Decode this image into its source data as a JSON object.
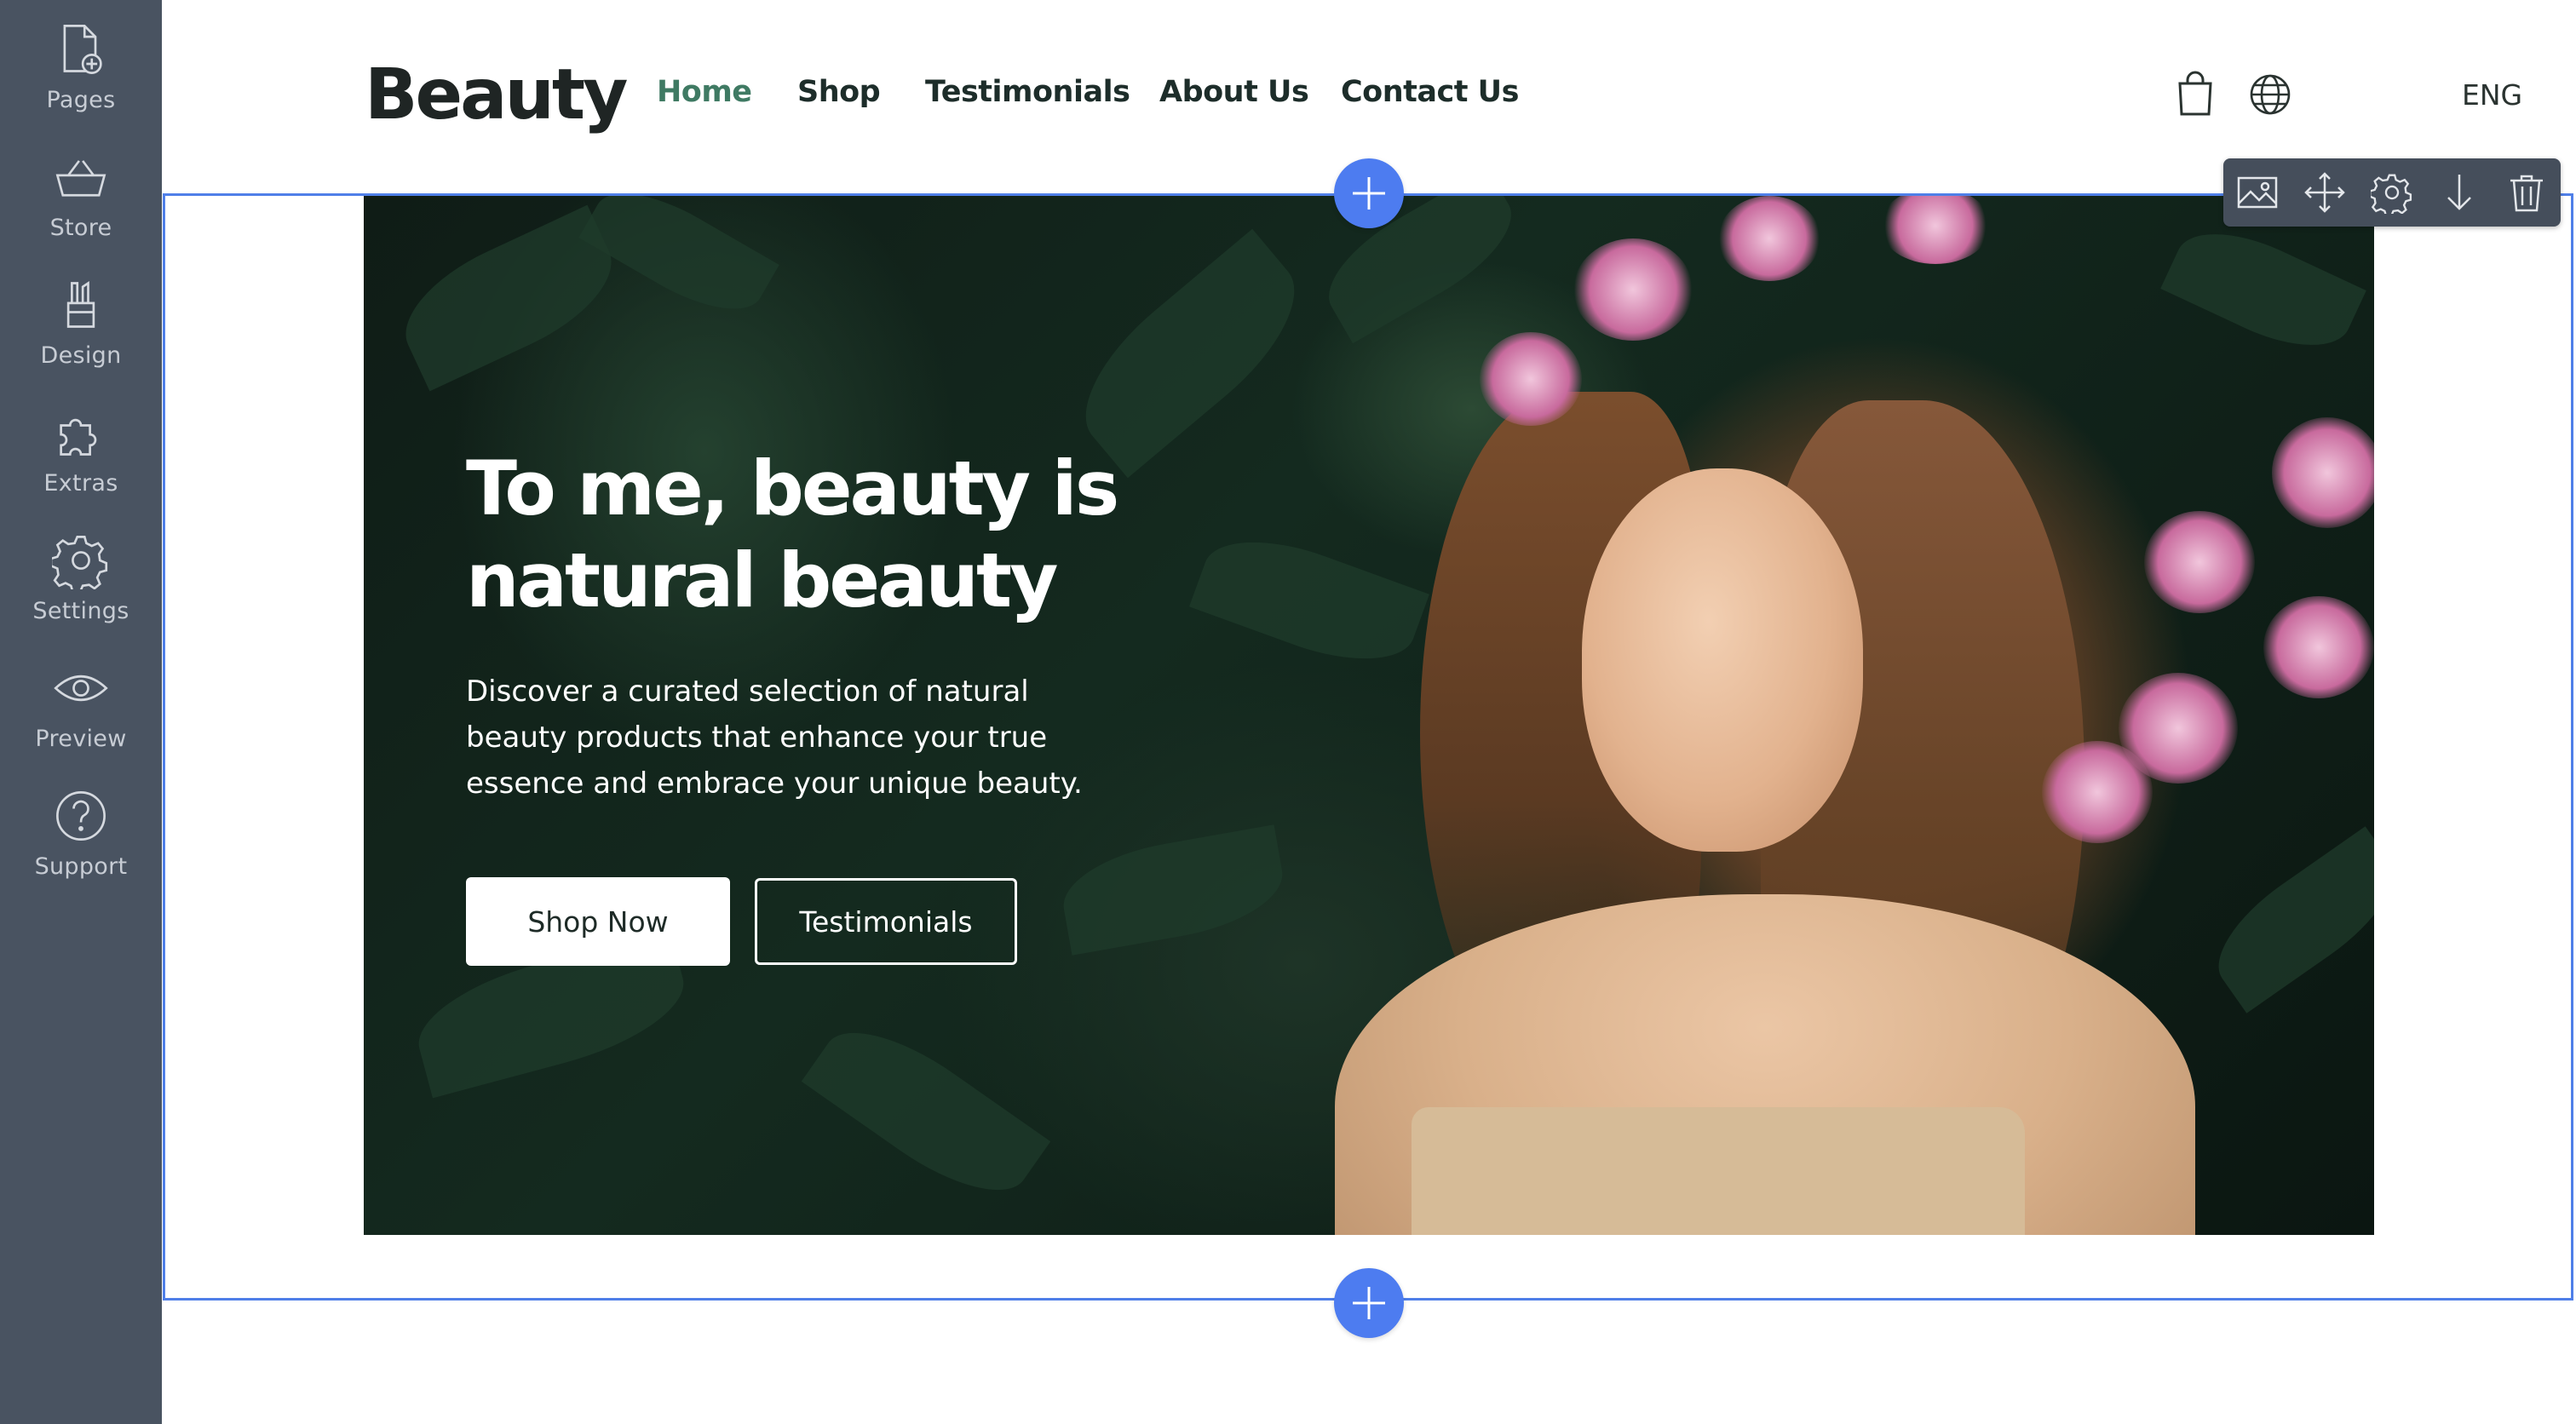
{
  "sidebar": {
    "items": [
      {
        "label": "Pages",
        "icon": "page-add-icon"
      },
      {
        "label": "Store",
        "icon": "basket-icon"
      },
      {
        "label": "Design",
        "icon": "brush-icon"
      },
      {
        "label": "Extras",
        "icon": "puzzle-icon"
      },
      {
        "label": "Settings",
        "icon": "gear-icon"
      },
      {
        "label": "Preview",
        "icon": "eye-icon"
      },
      {
        "label": "Support",
        "icon": "question-icon"
      }
    ]
  },
  "header": {
    "logo": "Beauty",
    "nav": [
      {
        "label": "Home",
        "active": true
      },
      {
        "label": "Shop",
        "active": false
      },
      {
        "label": "Testimonials",
        "active": false
      },
      {
        "label": "About Us",
        "active": false
      },
      {
        "label": "Contact Us",
        "active": false
      }
    ],
    "cart_icon": "shopping-bag-icon",
    "language_icon": "globe-icon",
    "language": "ENG"
  },
  "hero": {
    "title_line1": "To me, beauty is",
    "title_line2": "natural beauty",
    "description": "Discover a curated selection of natural beauty products that enhance your true essence and embrace your unique beauty.",
    "primary_button": "Shop Now",
    "secondary_button": "Testimonials"
  },
  "toolbar": {
    "tools": [
      "image-icon",
      "move-icon",
      "gear-icon",
      "arrow-down-icon",
      "trash-icon"
    ]
  },
  "colors": {
    "sidebar_bg": "#495361",
    "accent_nav": "#3f7a63",
    "selection_blue": "#4f7fe8",
    "add_button": "#4d7cf0",
    "toolbar_bg": "#454e5b"
  }
}
